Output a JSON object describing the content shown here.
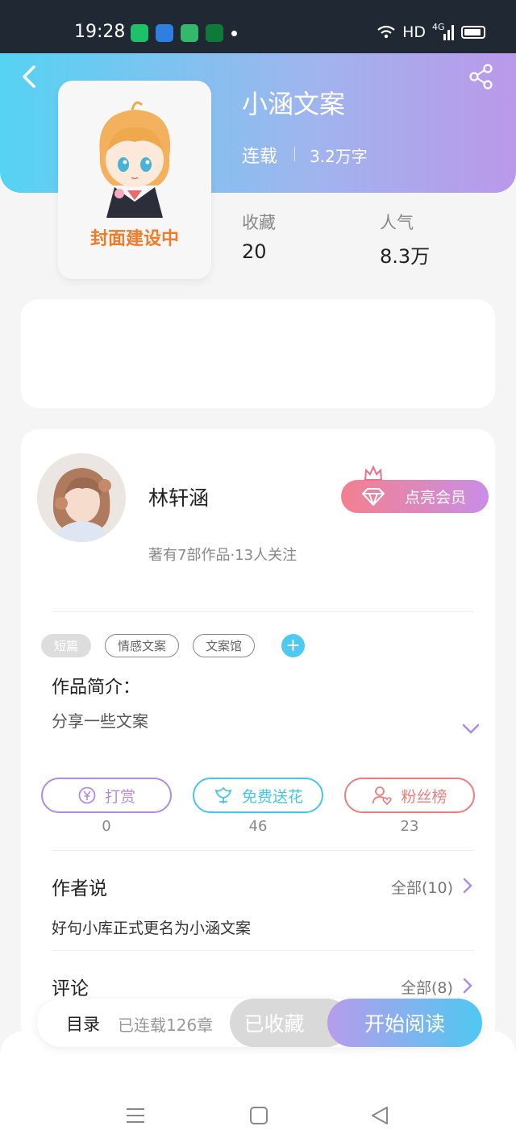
{
  "status_bar": {
    "time": "19:28",
    "network": "HD",
    "signal_label": "4G"
  },
  "book": {
    "title": "小涵文案",
    "status": "连载",
    "word_count": "3.2万字",
    "cover_text": "封面建设中",
    "stats": [
      {
        "label": "收藏",
        "value": "20"
      },
      {
        "label": "人气",
        "value": "8.3万"
      }
    ]
  },
  "author": {
    "name": "林轩涵",
    "meta": "著有7部作品·13人关注",
    "vip_button": "点亮会员"
  },
  "tags": [
    "短篇",
    "情感文案",
    "文案馆"
  ],
  "intro": {
    "title": "作品简介：",
    "text": "分享一些文案"
  },
  "actions": [
    {
      "label": "打赏",
      "count": "0",
      "color": "#b08be2"
    },
    {
      "label": "免费送花",
      "count": "46",
      "color": "#45c6e6"
    },
    {
      "label": "粉丝榜",
      "count": "23",
      "color": "#ea7e7e"
    }
  ],
  "author_says": {
    "title": "作者说",
    "more": "全部(10)",
    "text": "好句小库正式更名为小涵文案"
  },
  "comments": {
    "title": "评论",
    "more": "全部(8)"
  },
  "toolbar": {
    "catalog": "目录",
    "chapters": "已连载126章",
    "favorited": "已收藏",
    "start_reading": "开始阅读"
  },
  "colors": {
    "accent_purple": "#b08be2",
    "accent_cyan": "#45c6e6",
    "accent_red": "#ea7e7e",
    "cover_text": "#f07b28"
  }
}
